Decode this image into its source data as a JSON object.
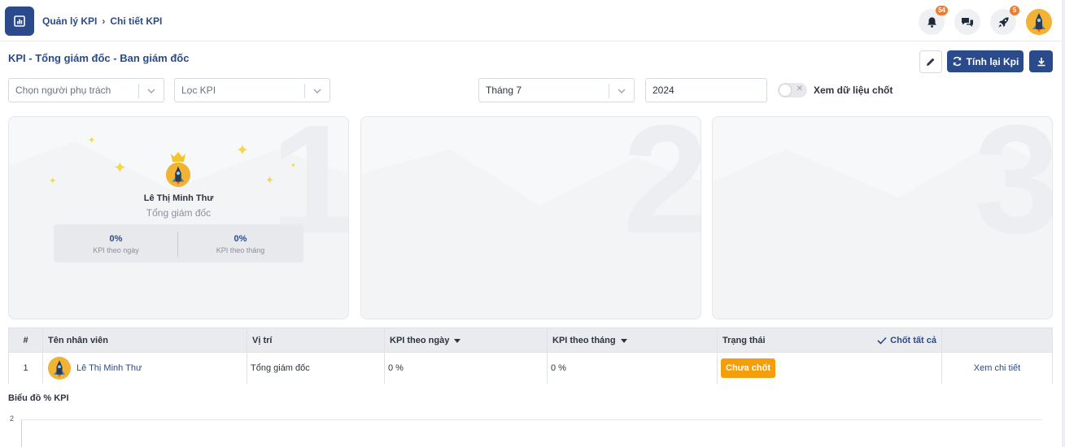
{
  "breadcrumb": {
    "items": [
      "Quản lý KPI",
      "Chi tiết KPI"
    ]
  },
  "notifications": {
    "bell_count": "54",
    "rocket_count": "5"
  },
  "page": {
    "title": "KPI - Tổng giám đốc - Ban giám đốc"
  },
  "actions": {
    "recalculate_label": "Tính lại Kpi"
  },
  "filters": {
    "person_placeholder": "Chọn người phụ trách",
    "kpi_placeholder": "Lọc KPI",
    "month_value": "Tháng 7",
    "year_value": "2024",
    "locked_toggle_label": "Xem dữ liệu chốt",
    "locked_toggle_on": false
  },
  "podium": {
    "ranks": [
      "1",
      "2",
      "3"
    ],
    "first": {
      "name": "Lê Thị Minh Thư",
      "role": "Tổng giám đốc",
      "daily_value": "0%",
      "daily_label": "KPI theo ngày",
      "monthly_value": "0%",
      "monthly_label": "KPI theo tháng"
    }
  },
  "table": {
    "headers": {
      "index": "#",
      "name": "Tên nhân viên",
      "position": "Vị trí",
      "kpi_day": "KPI theo ngày",
      "kpi_month": "KPI theo tháng",
      "status": "Trạng thái",
      "lock_all": "Chốt tất cả"
    },
    "rows": [
      {
        "index": "1",
        "name": "Lê Thị Minh Thư",
        "position": "Tổng giám đốc",
        "kpi_day": "0 %",
        "kpi_month": "0 %",
        "status": "Chưa chốt",
        "action": "Xem chi tiết"
      }
    ]
  },
  "chart": {
    "title": "Biểu đồ % KPI",
    "y_tick": "2"
  },
  "colors": {
    "primary": "#2b4a8b",
    "status_pending": "#f59e0b",
    "badge": "#f07c2f"
  }
}
